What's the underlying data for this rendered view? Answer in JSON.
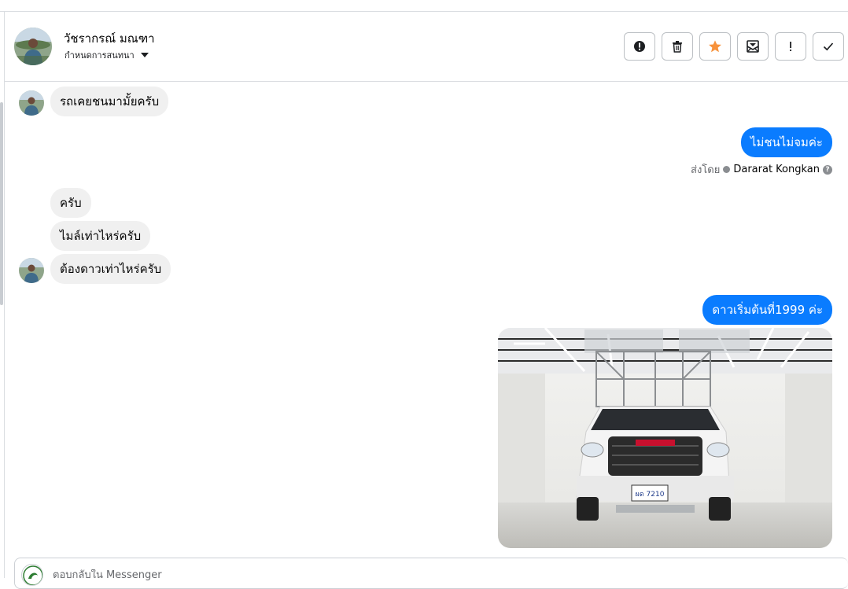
{
  "header": {
    "name": "วัชรากรณ์ มณฑา",
    "assign_label": "กำหนดการสนทนา",
    "actions": [
      {
        "icon": "alert-circle-icon",
        "tooltip": ""
      },
      {
        "icon": "trash-icon",
        "tooltip": ""
      },
      {
        "icon": "star-icon",
        "tooltip": ""
      },
      {
        "icon": "envelope-icon",
        "tooltip": ""
      },
      {
        "icon": "exclamation-icon",
        "tooltip": ""
      },
      {
        "icon": "check-icon",
        "tooltip": ""
      }
    ],
    "star_color": "#f7923b"
  },
  "messages": {
    "m1": "รถเคยชนมามั้ยครับ",
    "m2": "ไม่ชนไม่จมค่ะ",
    "sent_by_label": "ส่งโดย",
    "sent_by_name": "Dararat Kongkan",
    "m3": "ครับ",
    "m4": "ไมล์เท่าไหร่ครับ",
    "m5": "ต้องดาวเท่าไหร่ครับ",
    "m6": "ดาวเริ่มต้นที่1999 ค่ะ",
    "photo_plate": "ผด 7210"
  },
  "reply": {
    "placeholder": "ตอบกลับใน Messenger"
  },
  "colors": {
    "outgoing_bubble": "#0a7cff",
    "incoming_bubble": "#f0f0f0"
  }
}
